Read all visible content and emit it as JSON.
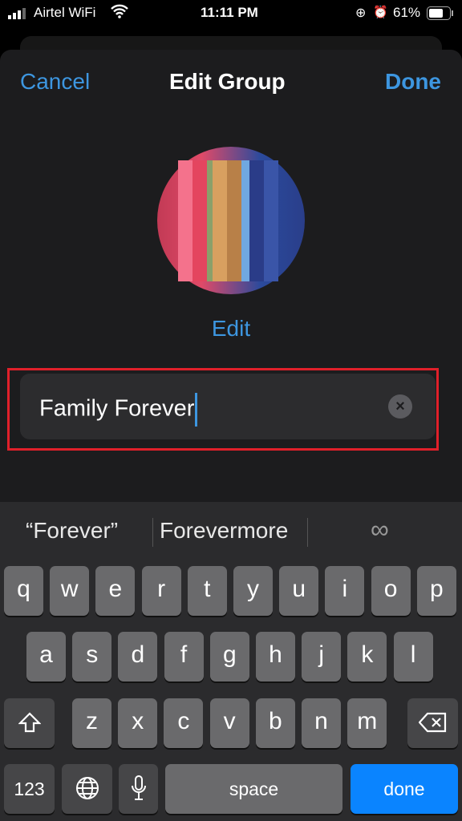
{
  "status": {
    "carrier": "Airtel WiFi",
    "time": "11:11 PM",
    "battery": "61%"
  },
  "nav": {
    "cancel": "Cancel",
    "title": "Edit Group",
    "done": "Done"
  },
  "avatar": {
    "edit_label": "Edit"
  },
  "field": {
    "value": "Family Forever"
  },
  "suggestions": [
    "“Forever”",
    "Forevermore",
    "∞"
  ],
  "keyboard": {
    "row1": [
      "q",
      "w",
      "e",
      "r",
      "t",
      "y",
      "u",
      "i",
      "o",
      "p"
    ],
    "row2": [
      "a",
      "s",
      "d",
      "f",
      "g",
      "h",
      "j",
      "k",
      "l"
    ],
    "row3": [
      "z",
      "x",
      "c",
      "v",
      "b",
      "n",
      "m"
    ],
    "numbers": "123",
    "space": "space",
    "done": "done"
  },
  "colors": {
    "accent": "#3d96e0",
    "highlight": "#e0202a",
    "done_key": "#0a84ff"
  }
}
